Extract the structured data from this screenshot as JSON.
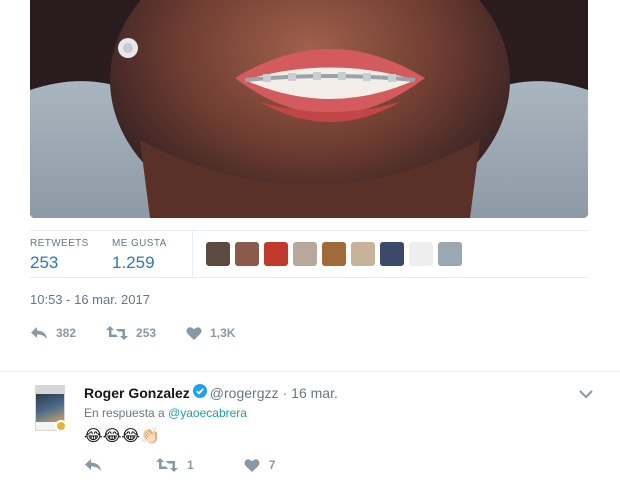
{
  "tweet": {
    "photo_alt": "",
    "retweets_label": "RETWEETS",
    "retweets_value": "253",
    "likes_label": "ME GUSTA",
    "likes_value": "1.259",
    "timestamp": "10:53 - 16 mar. 2017",
    "actions": {
      "reply_count": "382",
      "retweet_count": "253",
      "like_count": "1,3K"
    },
    "liker_avatars": [
      {
        "color": "#5a4a40"
      },
      {
        "color": "#8a5a4a"
      },
      {
        "color": "#c0392b"
      },
      {
        "color": "#b8a899"
      },
      {
        "color": "#a06a3a"
      },
      {
        "color": "#c7b29a"
      },
      {
        "color": "#3b4a6a"
      },
      {
        "color": "#eeeeee"
      },
      {
        "color": "#9aa8b4"
      }
    ]
  },
  "reply": {
    "name": "Roger Gonzalez",
    "handle": "@rogergzz",
    "separator": "·",
    "time": "16 mar.",
    "context_prefix": "En respuesta a",
    "context_handle": "@yaoecabrera",
    "text": "😂😂😂👏🏻",
    "actions": {
      "retweet_count": "1",
      "like_count": "7"
    }
  },
  "colors": {
    "accent": "#1da1f2",
    "stat_value": "#2b7bb9",
    "muted": "#657786",
    "icon": "#8899a6"
  }
}
